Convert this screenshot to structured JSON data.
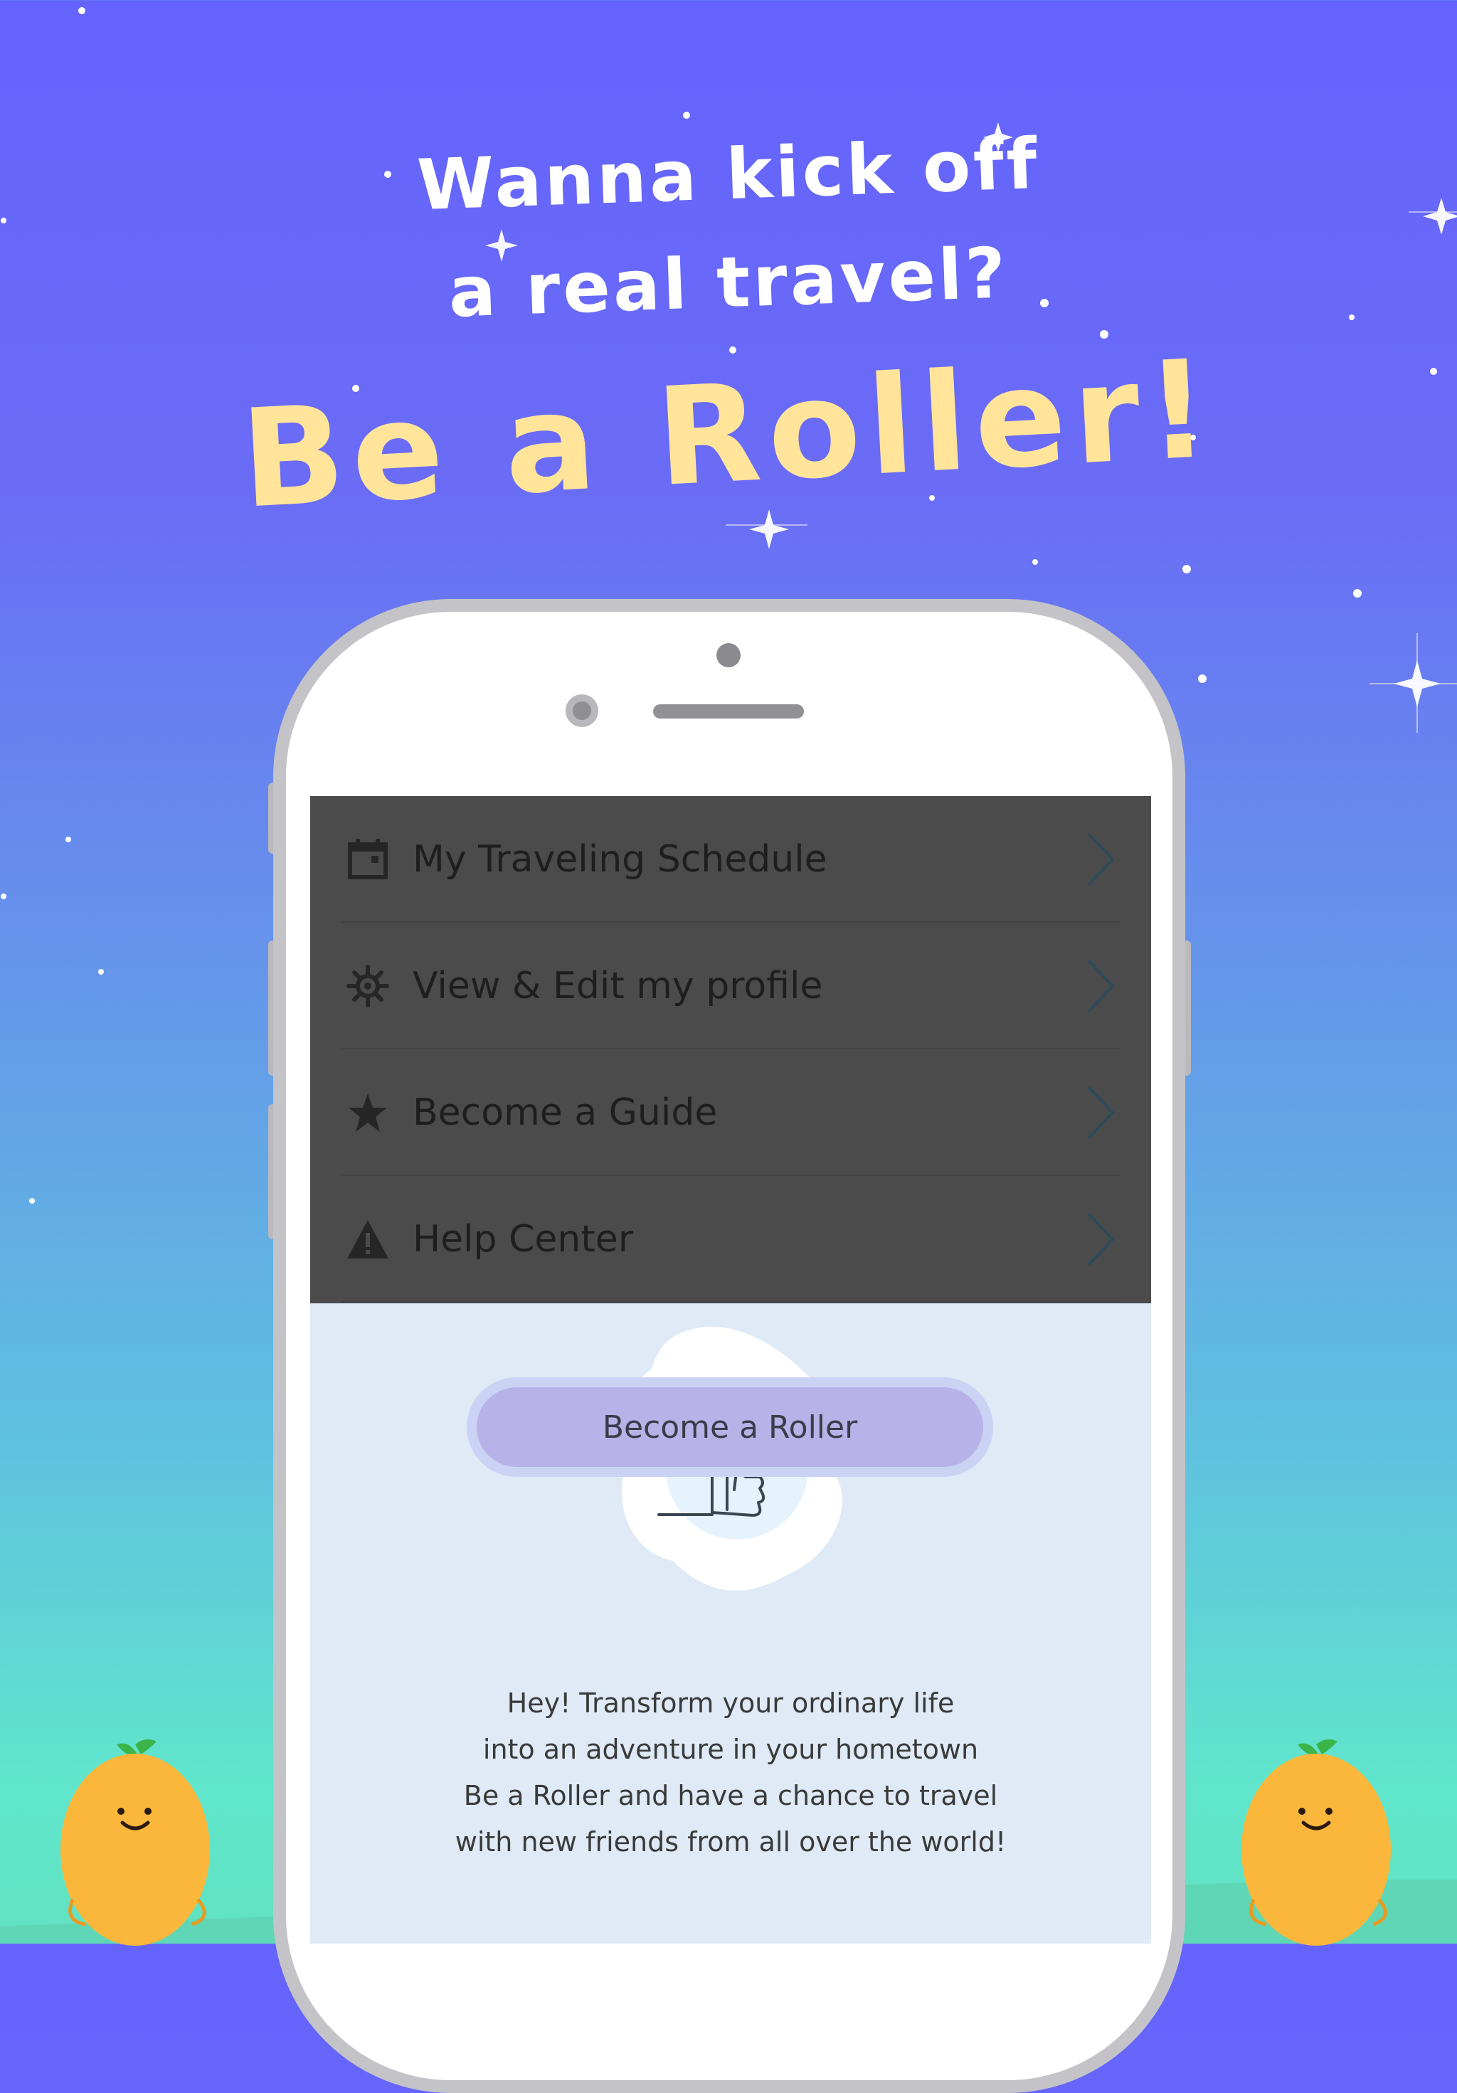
{
  "headline": {
    "line1": "Wanna kick off",
    "line2": "a real travel?"
  },
  "title": "Be a Roller!",
  "menu": {
    "items": [
      {
        "label": "My Traveling Schedule",
        "icon": "calendar-icon"
      },
      {
        "label": "View & Edit my profile",
        "icon": "gear-icon"
      },
      {
        "label": "Become a Guide",
        "icon": "star-icon"
      },
      {
        "label": "Help Center",
        "icon": "warning-icon"
      }
    ]
  },
  "promo": {
    "illustration": "hand-holding-flag",
    "lines": [
      "Hey! Transform your ordinary life",
      "into an adventure in your hometown",
      "Be a Roller and have a chance to travel",
      "with new friends from all over the world!"
    ],
    "button_label": "Become a Roller"
  },
  "colors": {
    "background_top": "#6563fe",
    "background_bottom": "#62e2c0",
    "title": "#ffe49a",
    "menu_bg": "#4b4b4b",
    "promo_bg": "#dfeaf6",
    "button": "#b7b3e8",
    "mascot": "#fbb73b"
  }
}
